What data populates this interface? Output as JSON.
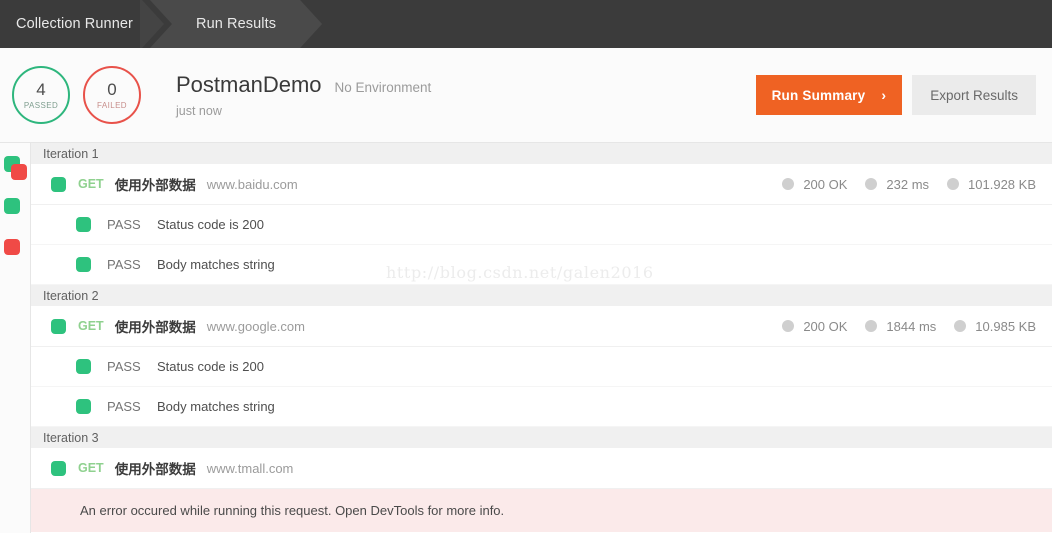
{
  "header": {
    "tabs": [
      {
        "label": "Collection Runner",
        "active": false
      },
      {
        "label": "Run Results",
        "active": true
      }
    ]
  },
  "summary": {
    "passed": {
      "count": "4",
      "label": "PASSED",
      "color": "#2eb67d"
    },
    "failed": {
      "count": "0",
      "label": "FAILED",
      "color": "#e8524a"
    },
    "collection_name": "PostmanDemo",
    "environment": "No Environment",
    "timestamp": "just now",
    "run_summary_button": "Run Summary",
    "run_summary_chevron": "›",
    "export_button": "Export Results",
    "primary_color": "#ef6223"
  },
  "sidebar": {
    "items": [
      {
        "name": "iteration-1-indicator",
        "type": "stacked",
        "colors": [
          "#2ec27e",
          "#f04a46"
        ]
      },
      {
        "name": "iteration-2-indicator",
        "type": "single",
        "colors": [
          "#2ec27e"
        ]
      },
      {
        "name": "iteration-3-indicator",
        "type": "single",
        "colors": [
          "#f04a46"
        ]
      }
    ]
  },
  "iterations": [
    {
      "label": "Iteration 1",
      "request": {
        "method": "GET",
        "name": "使用外部数据",
        "url": "www.baidu.com",
        "status": "200 OK",
        "time": "232 ms",
        "size": "101.928 KB"
      },
      "tests": [
        {
          "status": "PASS",
          "name": "Status code is 200"
        },
        {
          "status": "PASS",
          "name": "Body matches string"
        }
      ]
    },
    {
      "label": "Iteration 2",
      "request": {
        "method": "GET",
        "name": "使用外部数据",
        "url": "www.google.com",
        "status": "200 OK",
        "time": "1844 ms",
        "size": "10.985 KB"
      },
      "tests": [
        {
          "status": "PASS",
          "name": "Status code is 200"
        },
        {
          "status": "PASS",
          "name": "Body matches string"
        }
      ]
    },
    {
      "label": "Iteration 3",
      "request": {
        "method": "GET",
        "name": "使用外部数据",
        "url": "www.tmall.com",
        "status": "",
        "time": "",
        "size": ""
      },
      "error": "An error occured while running this request. Open DevTools for more info."
    }
  ],
  "watermark": "http://blog.csdn.net/galen2016"
}
